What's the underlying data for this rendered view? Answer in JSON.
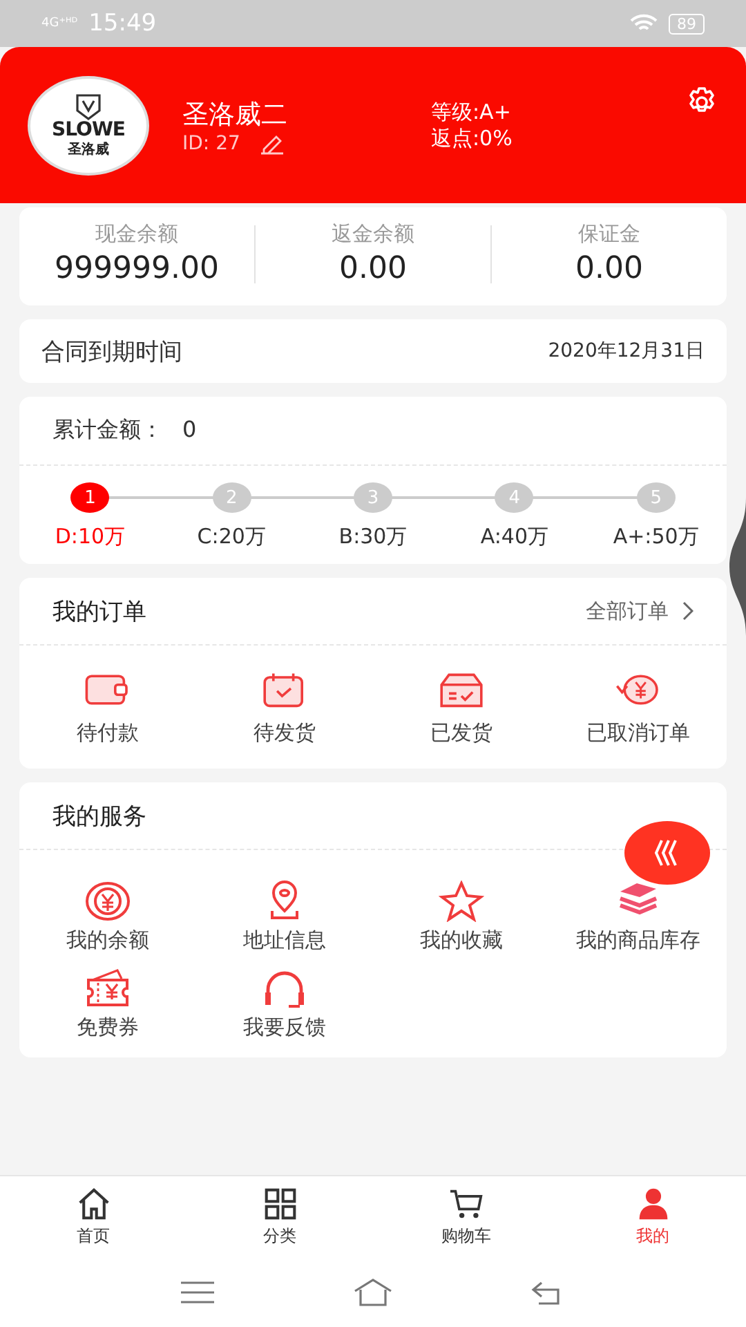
{
  "status_bar": {
    "network": "4G⁺ᴴᴰ",
    "time": "15:49",
    "battery": "89"
  },
  "profile": {
    "name": "圣洛威二",
    "id_label": "ID:  27",
    "level": "等级:A+",
    "rebate": "返点:0%",
    "logo_text": "SLOWE",
    "logo_subtext": "圣洛威"
  },
  "balances": [
    {
      "label": "现金余额",
      "value": "999999.00"
    },
    {
      "label": "返金余额",
      "value": "0.00"
    },
    {
      "label": "保证金",
      "value": "0.00"
    }
  ],
  "contract": {
    "label": "合同到期时间",
    "date": "2020年12月31日"
  },
  "cumulative": {
    "label": "累计金额：",
    "value": "0"
  },
  "steps": [
    {
      "number": "1",
      "label": "D:10万",
      "selected": true
    },
    {
      "number": "2",
      "label": "C:20万",
      "selected": false
    },
    {
      "number": "3",
      "label": "B:30万",
      "selected": false
    },
    {
      "number": "4",
      "label": "A:40万",
      "selected": false
    },
    {
      "number": "5",
      "label": "A+:50万",
      "selected": false
    }
  ],
  "orders": {
    "title": "我的订单",
    "all_link": "全部订单",
    "items": [
      {
        "kind": "wallet",
        "label": "待付款"
      },
      {
        "kind": "calendar",
        "label": "待发货"
      },
      {
        "kind": "box",
        "label": "已发货"
      },
      {
        "kind": "refund",
        "label": "已取消订单"
      }
    ]
  },
  "services": {
    "title": "我的服务",
    "items": [
      {
        "kind": "coin",
        "label": "我的余额"
      },
      {
        "kind": "location",
        "label": "地址信息"
      },
      {
        "kind": "star",
        "label": "我的收藏"
      },
      {
        "kind": "stack",
        "label": "我的商品库存"
      },
      {
        "kind": "ticket",
        "label": "免费券"
      },
      {
        "kind": "headset",
        "label": "我要反馈"
      }
    ]
  },
  "bottom_nav": [
    {
      "kind": "home",
      "label": "首页",
      "selected": false
    },
    {
      "kind": "grid",
      "label": "分类",
      "selected": false
    },
    {
      "kind": "cart",
      "label": "购物车",
      "selected": false
    },
    {
      "kind": "person",
      "label": "我的",
      "selected": true
    }
  ]
}
